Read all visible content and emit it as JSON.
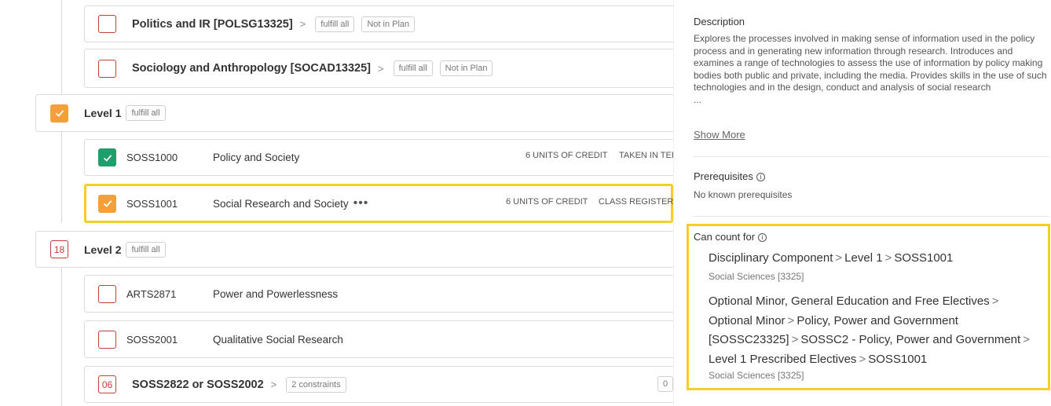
{
  "groups": [
    {
      "title": "Politics and IR [POLSG13325]",
      "chips": [
        "fulfill all",
        "Not in Plan"
      ]
    },
    {
      "title": "Sociology and Anthropology [SOCAD13325]",
      "chips": [
        "fulfill all",
        "Not in Plan"
      ]
    }
  ],
  "level1": {
    "title": "Level 1",
    "chip": "fulfill all"
  },
  "level1_courses": [
    {
      "code": "SOSS1000",
      "title": "Policy and Society",
      "units": "6 UNITS OF CREDIT",
      "status": "TAKEN IN TEF"
    },
    {
      "code": "SOSS1001",
      "title": "Social Research and Society",
      "more": "•••",
      "units": "6 UNITS OF CREDIT",
      "status": "CLASS REGISTERE"
    }
  ],
  "level2": {
    "badge": "18",
    "title": "Level 2",
    "chip": "fulfill all"
  },
  "level2_courses": [
    {
      "code": "ARTS2871",
      "title": "Power and Powerlessness"
    },
    {
      "code": "SOSS2001",
      "title": "Qualitative Social Research"
    }
  ],
  "level2_group": {
    "badge": "06",
    "title": "SOSS2822 or SOSS2002",
    "chip": "2 constraints",
    "trailing": "0"
  },
  "panel": {
    "description_label": "Description",
    "description_text": "Explores the processes involved in making sense of information used in the policy process and in generating new information through research. Introduces and examines a range of technologies to assess the use of information by policy making bodies both public and private, including the media. Provides skills in the use of such technologies and in the design, conduct and analysis of social research",
    "ellipsis": "...",
    "show_more": "Show More",
    "prereq_label": "Prerequisites",
    "prereq_text": "No known prerequisites",
    "can_count_label": "Can count for",
    "paths": [
      {
        "segments": [
          "Disciplinary Component",
          "Level 1",
          "SOSS1001"
        ],
        "sub": "Social Sciences [3325]"
      },
      {
        "segments": [
          "Optional Minor, General Education and Free Electives",
          "Optional Minor",
          "Policy, Power and Government [SOSSC23325]",
          "SOSSC2 - Policy, Power and Government",
          "Level 1 Prescribed Electives",
          "SOSS1001"
        ],
        "sub": "Social Sciences [3325]"
      }
    ]
  },
  "colors": {
    "highlight": "#f2d027",
    "green": "#1f9d6b",
    "orange": "#f3a03a",
    "red": "#c43d3d"
  },
  "icons": {
    "check": "check-icon",
    "chevron": "chevron-right-icon",
    "info": "info-icon"
  }
}
